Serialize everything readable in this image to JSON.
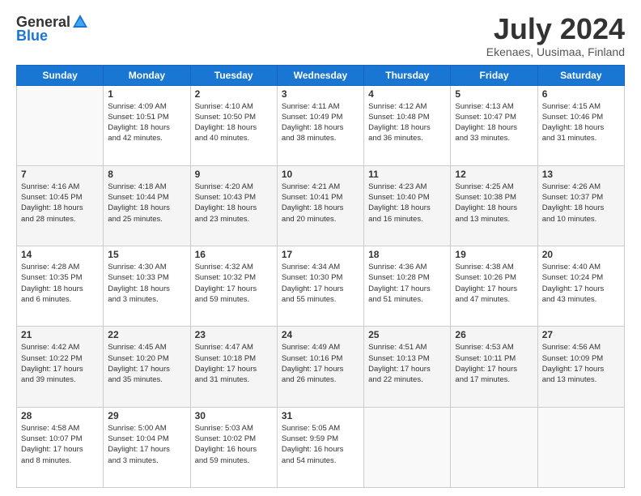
{
  "header": {
    "logo_general": "General",
    "logo_blue": "Blue",
    "month_title": "July 2024",
    "location": "Ekenaes, Uusimaa, Finland"
  },
  "days_of_week": [
    "Sunday",
    "Monday",
    "Tuesday",
    "Wednesday",
    "Thursday",
    "Friday",
    "Saturday"
  ],
  "weeks": [
    [
      {
        "day": "",
        "info": ""
      },
      {
        "day": "1",
        "info": "Sunrise: 4:09 AM\nSunset: 10:51 PM\nDaylight: 18 hours\nand 42 minutes."
      },
      {
        "day": "2",
        "info": "Sunrise: 4:10 AM\nSunset: 10:50 PM\nDaylight: 18 hours\nand 40 minutes."
      },
      {
        "day": "3",
        "info": "Sunrise: 4:11 AM\nSunset: 10:49 PM\nDaylight: 18 hours\nand 38 minutes."
      },
      {
        "day": "4",
        "info": "Sunrise: 4:12 AM\nSunset: 10:48 PM\nDaylight: 18 hours\nand 36 minutes."
      },
      {
        "day": "5",
        "info": "Sunrise: 4:13 AM\nSunset: 10:47 PM\nDaylight: 18 hours\nand 33 minutes."
      },
      {
        "day": "6",
        "info": "Sunrise: 4:15 AM\nSunset: 10:46 PM\nDaylight: 18 hours\nand 31 minutes."
      }
    ],
    [
      {
        "day": "7",
        "info": "Sunrise: 4:16 AM\nSunset: 10:45 PM\nDaylight: 18 hours\nand 28 minutes."
      },
      {
        "day": "8",
        "info": "Sunrise: 4:18 AM\nSunset: 10:44 PM\nDaylight: 18 hours\nand 25 minutes."
      },
      {
        "day": "9",
        "info": "Sunrise: 4:20 AM\nSunset: 10:43 PM\nDaylight: 18 hours\nand 23 minutes."
      },
      {
        "day": "10",
        "info": "Sunrise: 4:21 AM\nSunset: 10:41 PM\nDaylight: 18 hours\nand 20 minutes."
      },
      {
        "day": "11",
        "info": "Sunrise: 4:23 AM\nSunset: 10:40 PM\nDaylight: 18 hours\nand 16 minutes."
      },
      {
        "day": "12",
        "info": "Sunrise: 4:25 AM\nSunset: 10:38 PM\nDaylight: 18 hours\nand 13 minutes."
      },
      {
        "day": "13",
        "info": "Sunrise: 4:26 AM\nSunset: 10:37 PM\nDaylight: 18 hours\nand 10 minutes."
      }
    ],
    [
      {
        "day": "14",
        "info": "Sunrise: 4:28 AM\nSunset: 10:35 PM\nDaylight: 18 hours\nand 6 minutes."
      },
      {
        "day": "15",
        "info": "Sunrise: 4:30 AM\nSunset: 10:33 PM\nDaylight: 18 hours\nand 3 minutes."
      },
      {
        "day": "16",
        "info": "Sunrise: 4:32 AM\nSunset: 10:32 PM\nDaylight: 17 hours\nand 59 minutes."
      },
      {
        "day": "17",
        "info": "Sunrise: 4:34 AM\nSunset: 10:30 PM\nDaylight: 17 hours\nand 55 minutes."
      },
      {
        "day": "18",
        "info": "Sunrise: 4:36 AM\nSunset: 10:28 PM\nDaylight: 17 hours\nand 51 minutes."
      },
      {
        "day": "19",
        "info": "Sunrise: 4:38 AM\nSunset: 10:26 PM\nDaylight: 17 hours\nand 47 minutes."
      },
      {
        "day": "20",
        "info": "Sunrise: 4:40 AM\nSunset: 10:24 PM\nDaylight: 17 hours\nand 43 minutes."
      }
    ],
    [
      {
        "day": "21",
        "info": "Sunrise: 4:42 AM\nSunset: 10:22 PM\nDaylight: 17 hours\nand 39 minutes."
      },
      {
        "day": "22",
        "info": "Sunrise: 4:45 AM\nSunset: 10:20 PM\nDaylight: 17 hours\nand 35 minutes."
      },
      {
        "day": "23",
        "info": "Sunrise: 4:47 AM\nSunset: 10:18 PM\nDaylight: 17 hours\nand 31 minutes."
      },
      {
        "day": "24",
        "info": "Sunrise: 4:49 AM\nSunset: 10:16 PM\nDaylight: 17 hours\nand 26 minutes."
      },
      {
        "day": "25",
        "info": "Sunrise: 4:51 AM\nSunset: 10:13 PM\nDaylight: 17 hours\nand 22 minutes."
      },
      {
        "day": "26",
        "info": "Sunrise: 4:53 AM\nSunset: 10:11 PM\nDaylight: 17 hours\nand 17 minutes."
      },
      {
        "day": "27",
        "info": "Sunrise: 4:56 AM\nSunset: 10:09 PM\nDaylight: 17 hours\nand 13 minutes."
      }
    ],
    [
      {
        "day": "28",
        "info": "Sunrise: 4:58 AM\nSunset: 10:07 PM\nDaylight: 17 hours\nand 8 minutes."
      },
      {
        "day": "29",
        "info": "Sunrise: 5:00 AM\nSunset: 10:04 PM\nDaylight: 17 hours\nand 3 minutes."
      },
      {
        "day": "30",
        "info": "Sunrise: 5:03 AM\nSunset: 10:02 PM\nDaylight: 16 hours\nand 59 minutes."
      },
      {
        "day": "31",
        "info": "Sunrise: 5:05 AM\nSunset: 9:59 PM\nDaylight: 16 hours\nand 54 minutes."
      },
      {
        "day": "",
        "info": ""
      },
      {
        "day": "",
        "info": ""
      },
      {
        "day": "",
        "info": ""
      }
    ]
  ]
}
